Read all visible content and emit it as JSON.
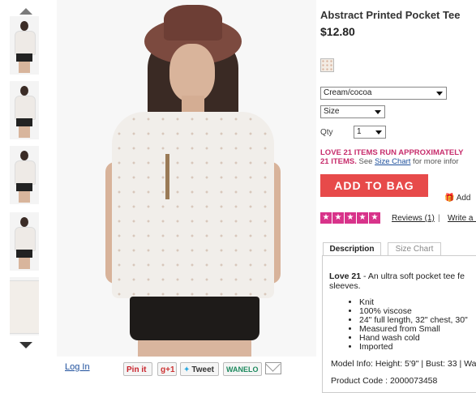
{
  "product": {
    "title": "Abstract Printed Pocket Tee",
    "price": "$12.80"
  },
  "thumbnails": [
    "front",
    "side",
    "back",
    "full-length",
    "closeup"
  ],
  "options": {
    "color_selected": "Cream/cocoa",
    "size_selected": "Size",
    "qty_label": "Qty",
    "qty_selected": "1"
  },
  "fit_notice": {
    "line1": "LOVE 21 ITEMS RUN APPROXIMATELY ",
    "line2_bold": "21 ITEMS.",
    "line2_see": " See ",
    "size_chart_link": "Size Chart",
    "line2_rest": " for more infor"
  },
  "actions": {
    "add_to_bag": "ADD TO BAG",
    "add_to_wishlist": "Add"
  },
  "reviews": {
    "stars": 5,
    "label": "Reviews (1)",
    "separator": "|",
    "write": "Write a R"
  },
  "tabs": {
    "description": "Description",
    "size_chart": "Size Chart"
  },
  "description": {
    "brand": "Love 21",
    "text": " - An ultra soft pocket tee fe sleeves.",
    "bullets": [
      "Knit",
      "100% viscose",
      "24\" full length, 32\" chest, 30\"",
      "Measured from Small",
      "Hand wash cold",
      "Imported"
    ],
    "model_info": "Model Info: Height: 5'9\" | Bust: 33 | Wa",
    "product_code": "Product Code : 2000073458"
  },
  "social": {
    "login": "Log In",
    "pinit": "Pin it",
    "gplus": "g+1",
    "tweet": "Tweet",
    "wanelo": "WANELO"
  }
}
